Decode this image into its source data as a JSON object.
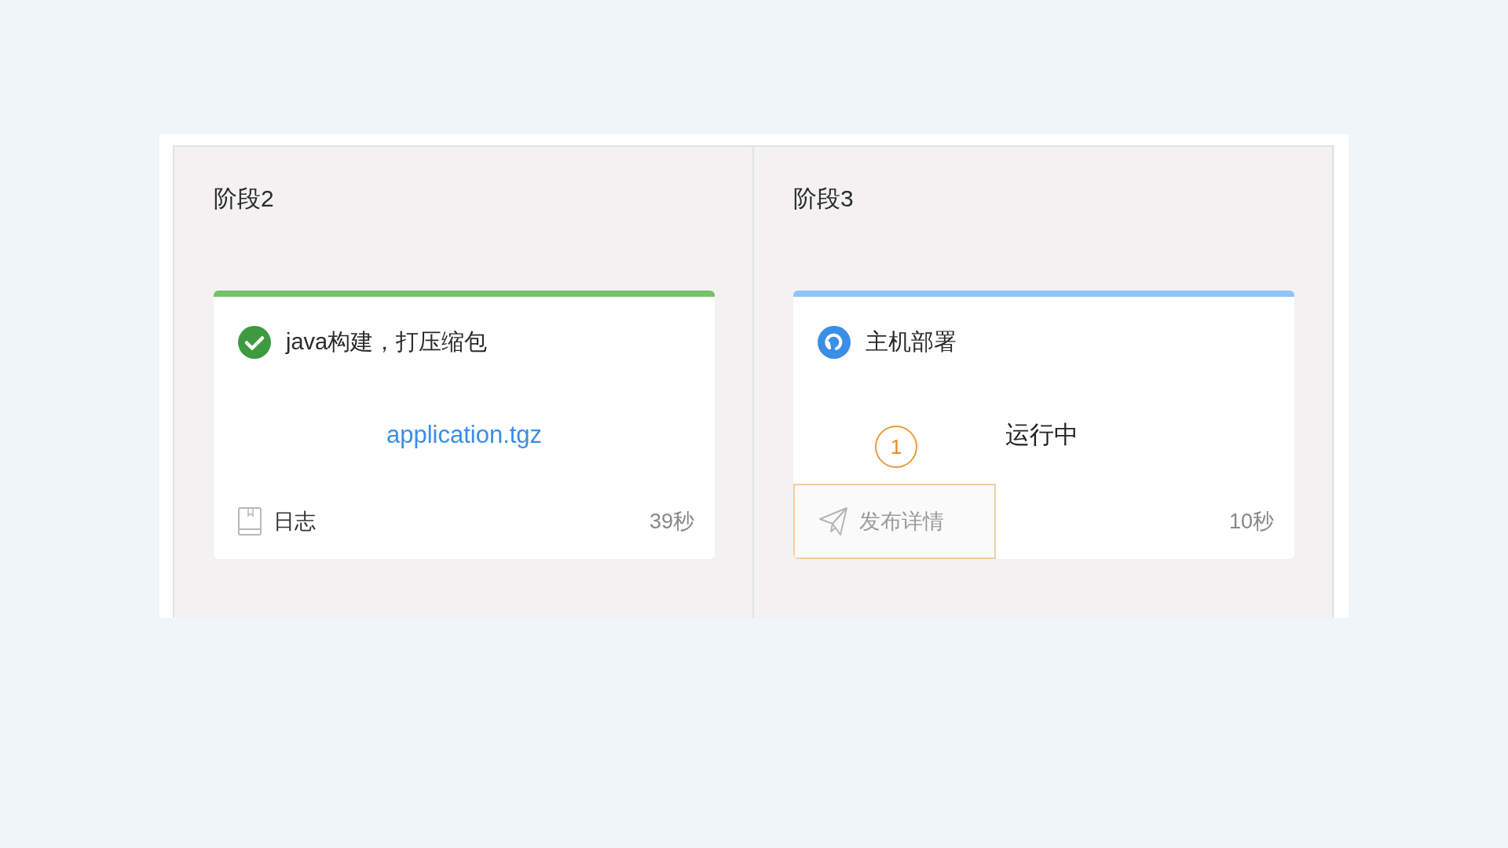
{
  "stages": [
    {
      "title": "阶段2",
      "card": {
        "kind": "success",
        "name": "java构建，打压缩包",
        "body": {
          "kind": "link",
          "text": "application.tgz"
        },
        "action": {
          "kind": "log",
          "label": "日志",
          "highlighted": false
        },
        "duration": "39秒"
      }
    },
    {
      "title": "阶段3",
      "card": {
        "kind": "running",
        "name": "主机部署",
        "body": {
          "kind": "text",
          "text": "运行中"
        },
        "action": {
          "kind": "details",
          "label": "发布详情",
          "highlighted": true,
          "callout": "1"
        },
        "duration": "10秒"
      }
    }
  ]
}
